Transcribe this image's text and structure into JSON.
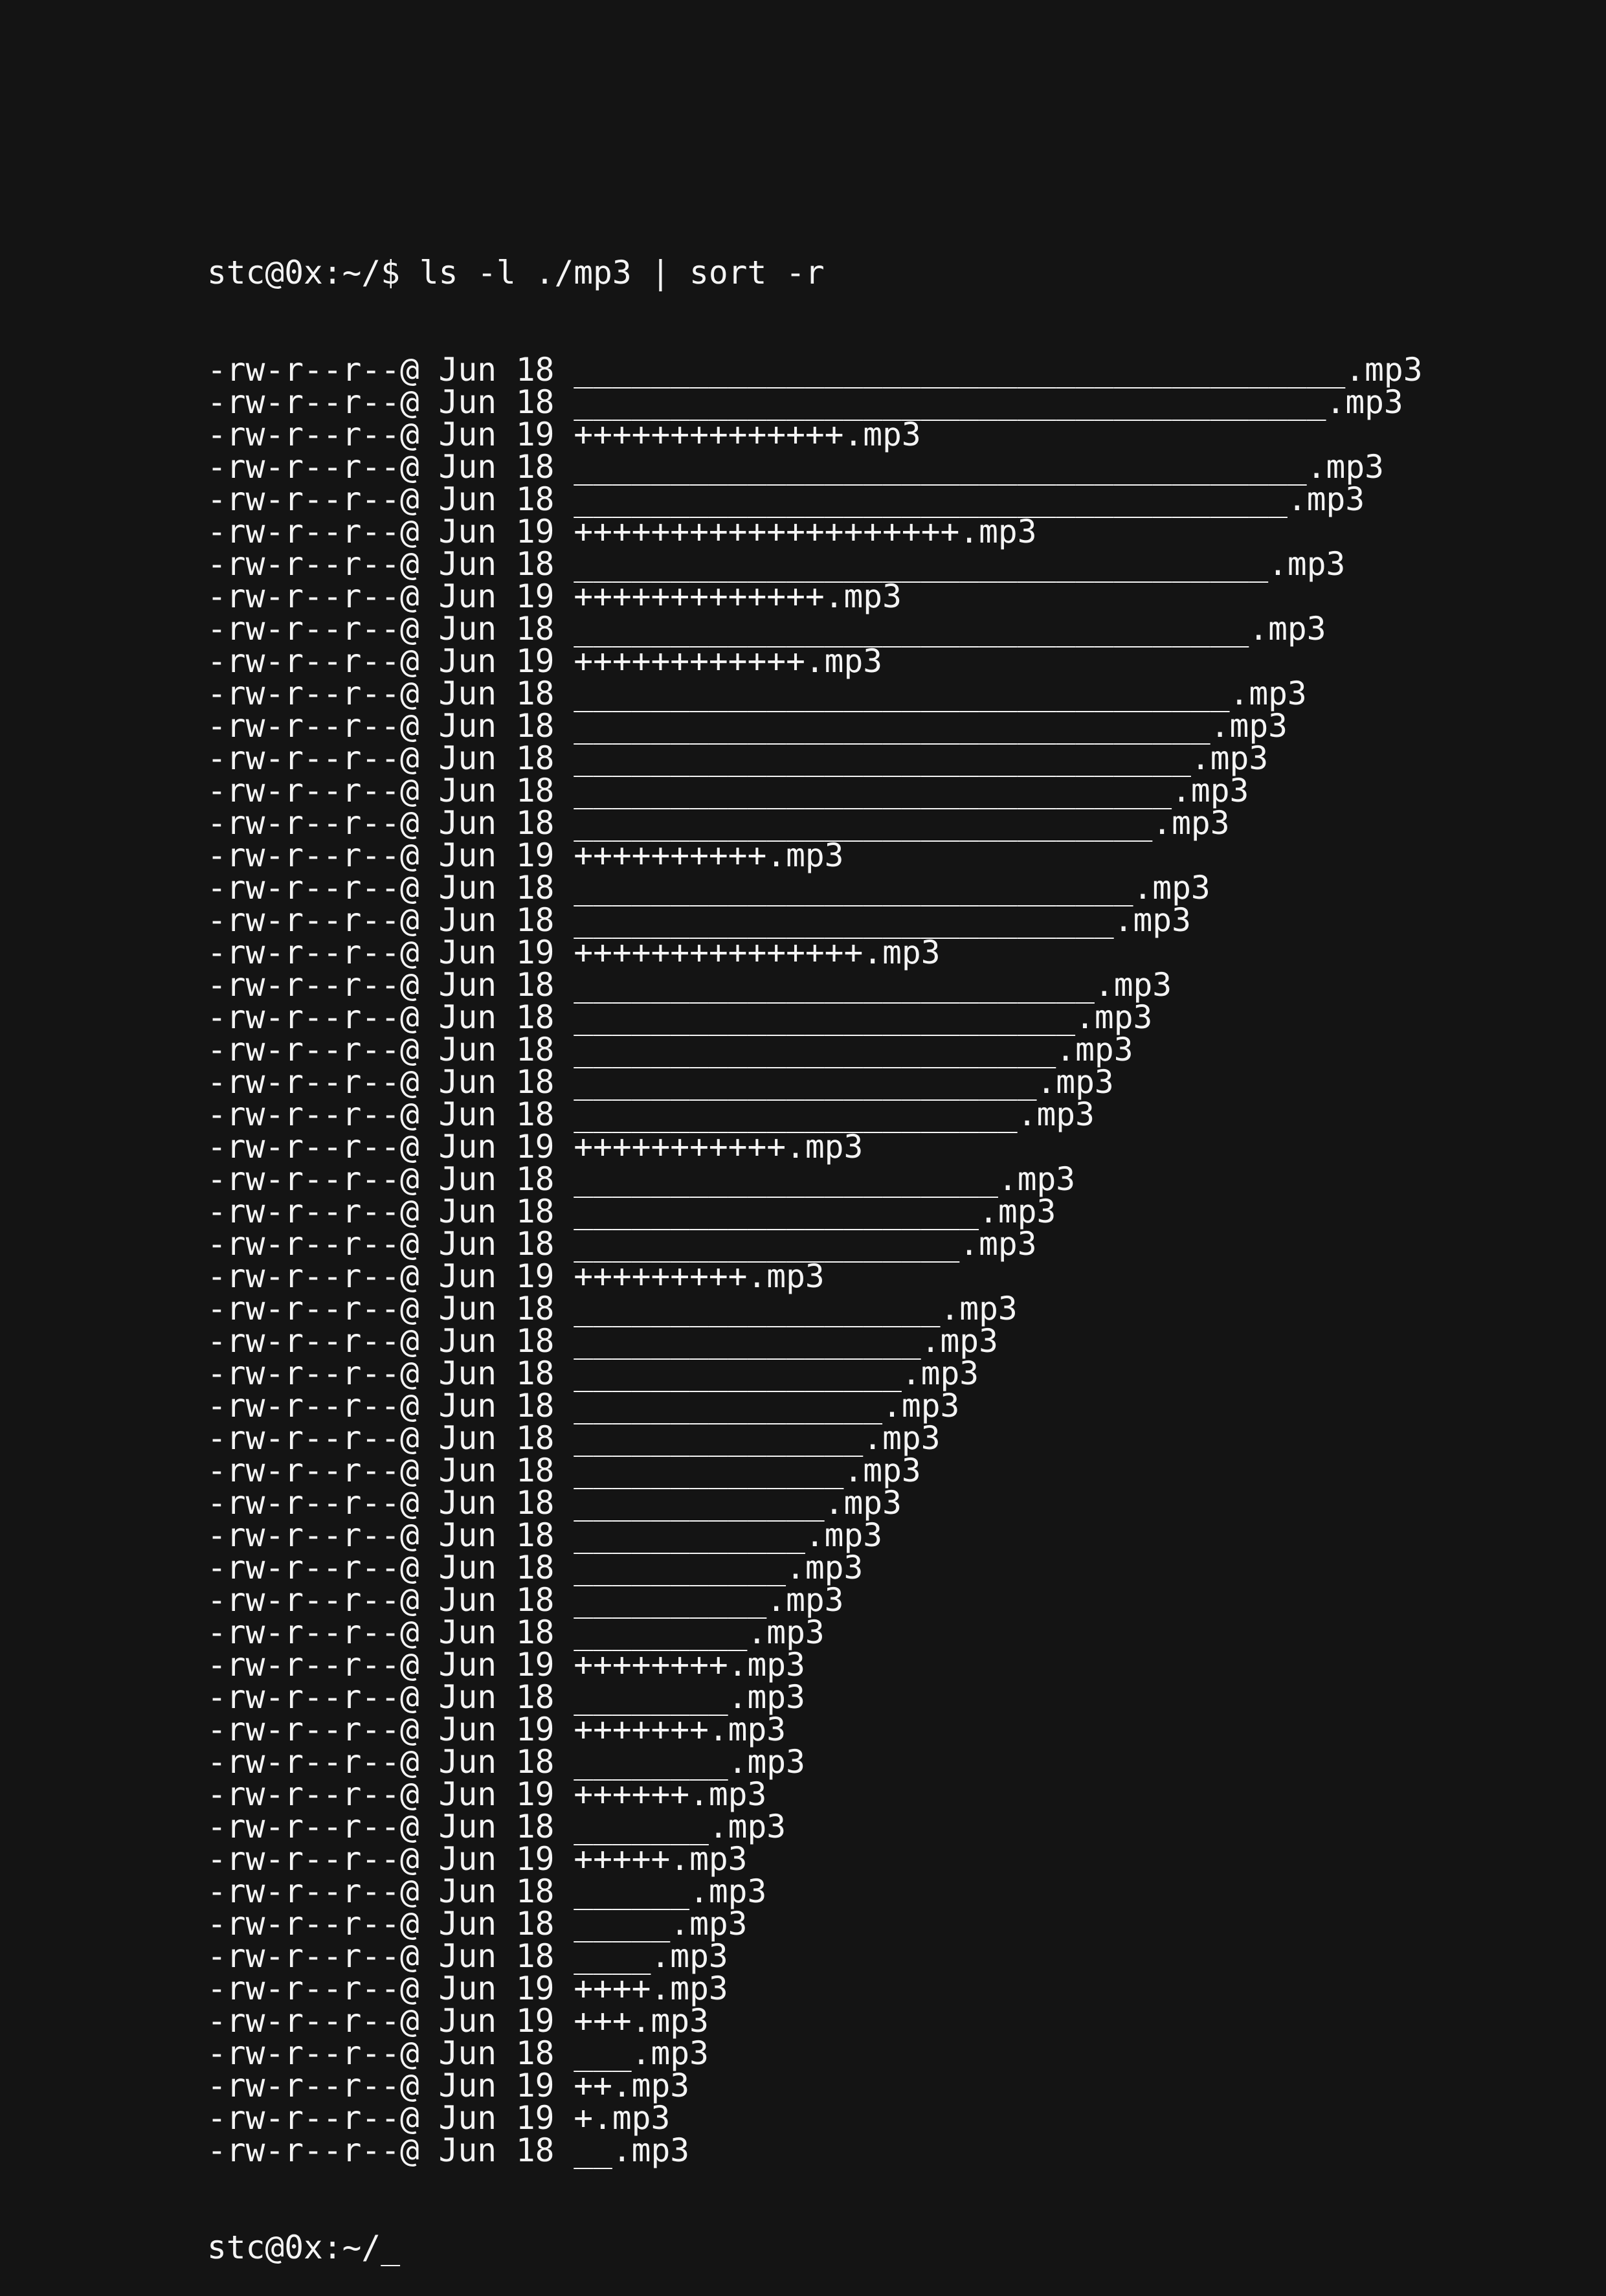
{
  "terminal": {
    "prompt": "stc@0x:~/$",
    "command": "ls -l ./mp3 | sort -r",
    "entries": [
      {
        "perms": "-rw-r--r--@",
        "date": "Jun 18",
        "name": "________________________________________.mp3"
      },
      {
        "perms": "-rw-r--r--@",
        "date": "Jun 18",
        "name": "_______________________________________.mp3"
      },
      {
        "perms": "-rw-r--r--@",
        "date": "Jun 19",
        "name": "++++++++++++++.mp3"
      },
      {
        "perms": "-rw-r--r--@",
        "date": "Jun 18",
        "name": "______________________________________.mp3"
      },
      {
        "perms": "-rw-r--r--@",
        "date": "Jun 18",
        "name": "_____________________________________.mp3"
      },
      {
        "perms": "-rw-r--r--@",
        "date": "Jun 19",
        "name": "++++++++++++++++++++.mp3"
      },
      {
        "perms": "-rw-r--r--@",
        "date": "Jun 18",
        "name": "____________________________________.mp3"
      },
      {
        "perms": "-rw-r--r--@",
        "date": "Jun 19",
        "name": "+++++++++++++.mp3"
      },
      {
        "perms": "-rw-r--r--@",
        "date": "Jun 18",
        "name": "___________________________________.mp3"
      },
      {
        "perms": "-rw-r--r--@",
        "date": "Jun 19",
        "name": "++++++++++++.mp3"
      },
      {
        "perms": "-rw-r--r--@",
        "date": "Jun 18",
        "name": "__________________________________.mp3"
      },
      {
        "perms": "-rw-r--r--@",
        "date": "Jun 18",
        "name": "_________________________________.mp3"
      },
      {
        "perms": "-rw-r--r--@",
        "date": "Jun 18",
        "name": "________________________________.mp3"
      },
      {
        "perms": "-rw-r--r--@",
        "date": "Jun 18",
        "name": "_______________________________.mp3"
      },
      {
        "perms": "-rw-r--r--@",
        "date": "Jun 18",
        "name": "______________________________.mp3"
      },
      {
        "perms": "-rw-r--r--@",
        "date": "Jun 19",
        "name": "++++++++++.mp3"
      },
      {
        "perms": "-rw-r--r--@",
        "date": "Jun 18",
        "name": "_____________________________.mp3"
      },
      {
        "perms": "-rw-r--r--@",
        "date": "Jun 18",
        "name": "____________________________.mp3"
      },
      {
        "perms": "-rw-r--r--@",
        "date": "Jun 19",
        "name": "+++++++++++++++.mp3"
      },
      {
        "perms": "-rw-r--r--@",
        "date": "Jun 18",
        "name": "___________________________.mp3"
      },
      {
        "perms": "-rw-r--r--@",
        "date": "Jun 18",
        "name": "__________________________.mp3"
      },
      {
        "perms": "-rw-r--r--@",
        "date": "Jun 18",
        "name": "_________________________.mp3"
      },
      {
        "perms": "-rw-r--r--@",
        "date": "Jun 18",
        "name": "________________________.mp3"
      },
      {
        "perms": "-rw-r--r--@",
        "date": "Jun 18",
        "name": "_______________________.mp3"
      },
      {
        "perms": "-rw-r--r--@",
        "date": "Jun 19",
        "name": "+++++++++++.mp3"
      },
      {
        "perms": "-rw-r--r--@",
        "date": "Jun 18",
        "name": "______________________.mp3"
      },
      {
        "perms": "-rw-r--r--@",
        "date": "Jun 18",
        "name": "_____________________.mp3"
      },
      {
        "perms": "-rw-r--r--@",
        "date": "Jun 18",
        "name": "____________________.mp3"
      },
      {
        "perms": "-rw-r--r--@",
        "date": "Jun 19",
        "name": "+++++++++.mp3"
      },
      {
        "perms": "-rw-r--r--@",
        "date": "Jun 18",
        "name": "___________________.mp3"
      },
      {
        "perms": "-rw-r--r--@",
        "date": "Jun 18",
        "name": "__________________.mp3"
      },
      {
        "perms": "-rw-r--r--@",
        "date": "Jun 18",
        "name": "_________________.mp3"
      },
      {
        "perms": "-rw-r--r--@",
        "date": "Jun 18",
        "name": "________________.mp3"
      },
      {
        "perms": "-rw-r--r--@",
        "date": "Jun 18",
        "name": "_______________.mp3"
      },
      {
        "perms": "-rw-r--r--@",
        "date": "Jun 18",
        "name": "______________.mp3"
      },
      {
        "perms": "-rw-r--r--@",
        "date": "Jun 18",
        "name": "_____________.mp3"
      },
      {
        "perms": "-rw-r--r--@",
        "date": "Jun 18",
        "name": "____________.mp3"
      },
      {
        "perms": "-rw-r--r--@",
        "date": "Jun 18",
        "name": "___________.mp3"
      },
      {
        "perms": "-rw-r--r--@",
        "date": "Jun 18",
        "name": "__________.mp3"
      },
      {
        "perms": "-rw-r--r--@",
        "date": "Jun 18",
        "name": "_________.mp3"
      },
      {
        "perms": "-rw-r--r--@",
        "date": "Jun 19",
        "name": "++++++++.mp3"
      },
      {
        "perms": "-rw-r--r--@",
        "date": "Jun 18",
        "name": "________.mp3"
      },
      {
        "perms": "-rw-r--r--@",
        "date": "Jun 19",
        "name": "+++++++.mp3"
      },
      {
        "perms": "-rw-r--r--@",
        "date": "Jun 18",
        "name": "________.mp3"
      },
      {
        "perms": "-rw-r--r--@",
        "date": "Jun 19",
        "name": "++++++.mp3"
      },
      {
        "perms": "-rw-r--r--@",
        "date": "Jun 18",
        "name": "_______.mp3"
      },
      {
        "perms": "-rw-r--r--@",
        "date": "Jun 19",
        "name": "+++++.mp3"
      },
      {
        "perms": "-rw-r--r--@",
        "date": "Jun 18",
        "name": "______.mp3"
      },
      {
        "perms": "-rw-r--r--@",
        "date": "Jun 18",
        "name": "_____.mp3"
      },
      {
        "perms": "-rw-r--r--@",
        "date": "Jun 18",
        "name": "____.mp3"
      },
      {
        "perms": "-rw-r--r--@",
        "date": "Jun 19",
        "name": "++++.mp3"
      },
      {
        "perms": "-rw-r--r--@",
        "date": "Jun 19",
        "name": "+++.mp3"
      },
      {
        "perms": "-rw-r--r--@",
        "date": "Jun 18",
        "name": "___.mp3"
      },
      {
        "perms": "-rw-r--r--@",
        "date": "Jun 19",
        "name": "++.mp3"
      },
      {
        "perms": "-rw-r--r--@",
        "date": "Jun 19",
        "name": "+.mp3"
      },
      {
        "perms": "-rw-r--r--@",
        "date": "Jun 18",
        "name": "__.mp3"
      }
    ],
    "final_prompt": "stc@0x:~/",
    "cursor": "_"
  },
  "colors": {
    "background": "#141414",
    "foreground": "#f4f4f4"
  }
}
